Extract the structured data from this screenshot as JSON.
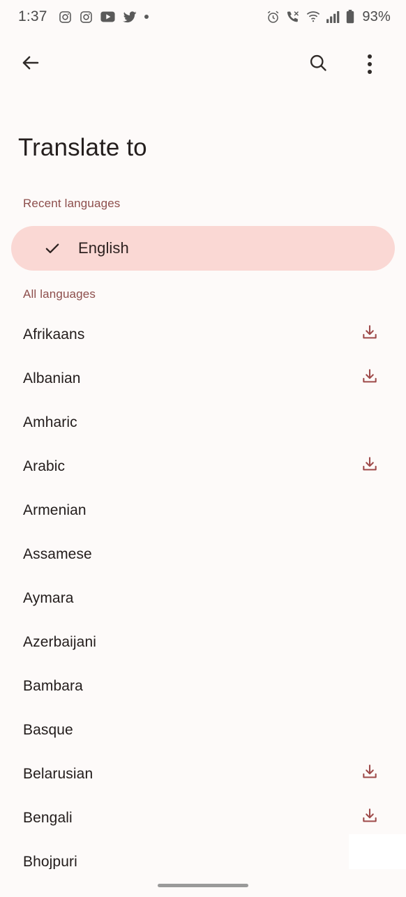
{
  "status_bar": {
    "time": "1:37",
    "left_icons": [
      "instagram-icon",
      "instagram-icon",
      "youtube-icon",
      "twitter-icon",
      "more-notifications-dot"
    ],
    "right_icons": [
      "alarm-icon",
      "missed-call-icon",
      "wifi-icon",
      "cellular-signal-icon",
      "battery-icon"
    ],
    "battery_percent": "93%"
  },
  "app_bar": {
    "back_label": "Back",
    "search_label": "Search",
    "overflow_label": "More options",
    "icons": [
      "back-arrow-icon",
      "search-icon",
      "overflow-menu-icon"
    ]
  },
  "page": {
    "title": "Translate to"
  },
  "sections": {
    "recent_header": "Recent languages",
    "all_header": "All languages"
  },
  "recent_languages": [
    {
      "name": "English",
      "selected": true,
      "downloadable": false
    }
  ],
  "all_languages": [
    {
      "name": "Afrikaans",
      "downloadable": true
    },
    {
      "name": "Albanian",
      "downloadable": true
    },
    {
      "name": "Amharic",
      "downloadable": false
    },
    {
      "name": "Arabic",
      "downloadable": true
    },
    {
      "name": "Armenian",
      "downloadable": false
    },
    {
      "name": "Assamese",
      "downloadable": false
    },
    {
      "name": "Aymara",
      "downloadable": false
    },
    {
      "name": "Azerbaijani",
      "downloadable": false
    },
    {
      "name": "Bambara",
      "downloadable": false
    },
    {
      "name": "Basque",
      "downloadable": false
    },
    {
      "name": "Belarusian",
      "downloadable": true
    },
    {
      "name": "Bengali",
      "downloadable": true
    },
    {
      "name": "Bhojpuri",
      "downloadable": false
    }
  ],
  "icons": {
    "check": "check-icon",
    "download": "download-icon",
    "gesture": "gesture-navigation-bar"
  },
  "colors": {
    "background": "#fdfaf9",
    "selected_pill": "#fad8d4",
    "accent_text": "#8d4e4c",
    "download_icon": "#9e4a4a",
    "primary_text": "#221c1b"
  }
}
